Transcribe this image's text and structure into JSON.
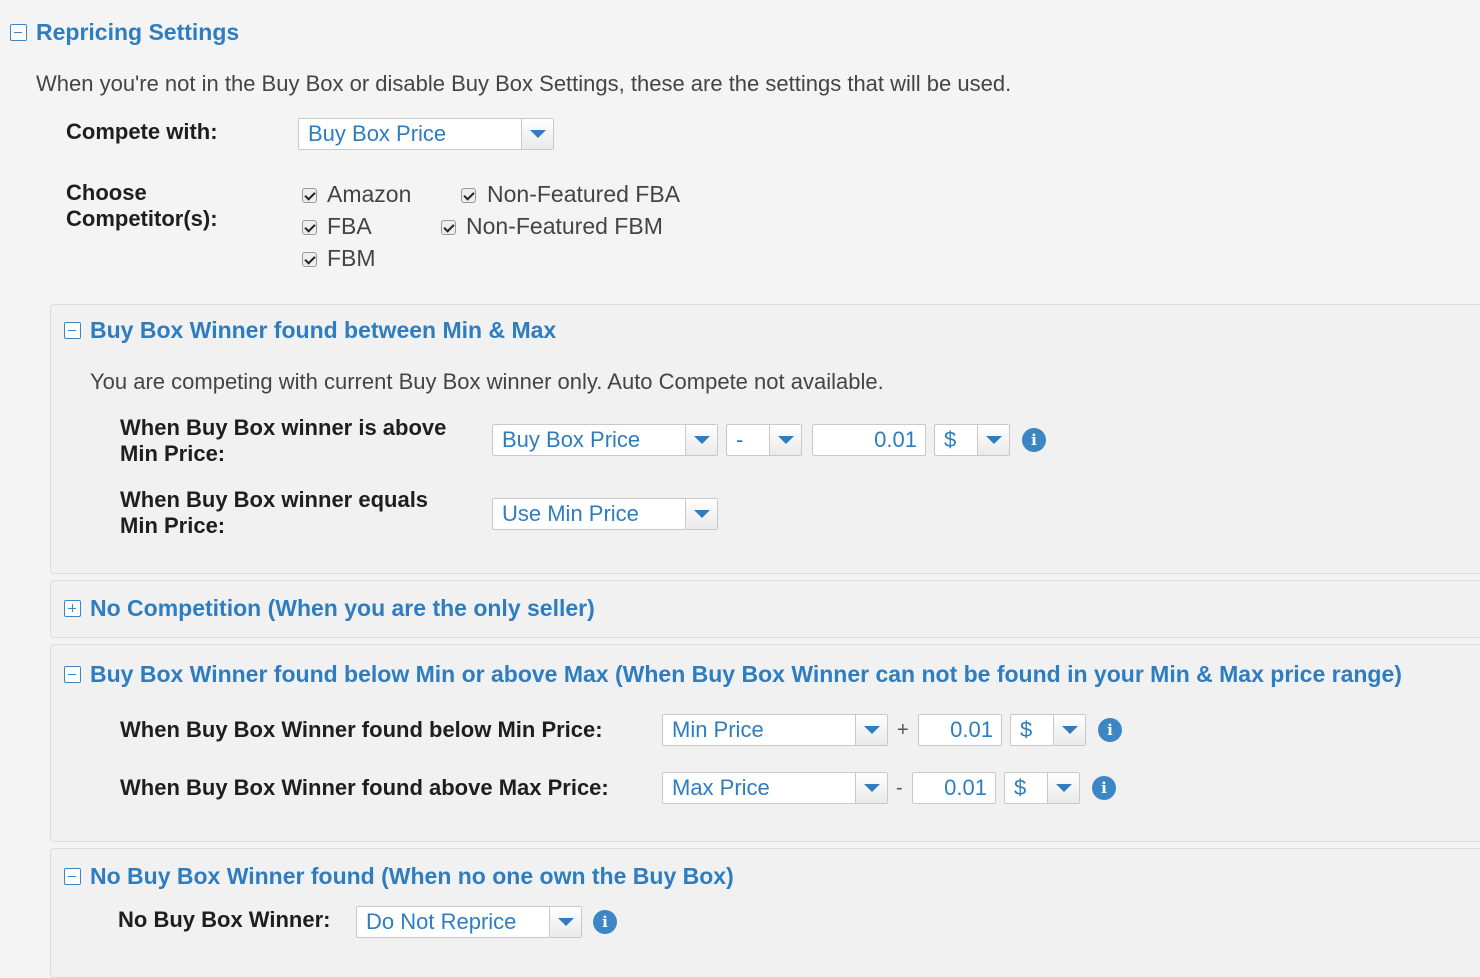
{
  "repricing": {
    "title": "Repricing Settings",
    "description": "When you're not in the Buy Box or disable Buy Box Settings, these are the settings that will be used.",
    "compete_with_label": "Compete with:",
    "compete_with_value": "Buy Box Price",
    "choose_label_1": "Choose",
    "choose_label_2": "Competitor(s):",
    "competitors": [
      {
        "label": "Amazon",
        "checked": true
      },
      {
        "label": "FBA",
        "checked": true
      },
      {
        "label": "FBM",
        "checked": true
      },
      {
        "label": "Non-Featured FBA",
        "checked": true
      },
      {
        "label": "Non-Featured FBM",
        "checked": true
      }
    ]
  },
  "section_between": {
    "title": "Buy Box Winner found between Min & Max",
    "description": "You are competing with current Buy Box winner only. Auto Compete not available.",
    "above_label_1": "When Buy Box winner is above",
    "above_label_2": "Min Price:",
    "above_price": "Buy Box Price",
    "above_operator": "-",
    "above_amount": "0.01",
    "above_unit": "$",
    "equals_label_1": "When Buy Box winner equals",
    "equals_label_2": "Min Price:",
    "equals_value": "Use Min Price"
  },
  "section_no_competition": {
    "title": "No Competition (When you are the only seller)"
  },
  "section_outside": {
    "title": "Buy Box Winner found below Min or above Max (When Buy Box Winner can not be found in your Min & Max price range)",
    "below_label": "When Buy Box Winner found below Min Price:",
    "below_price": "Min Price",
    "below_operator": "+",
    "below_amount": "0.01",
    "below_unit": "$",
    "above_label": "When Buy Box Winner found above Max Price:",
    "above_price": "Max Price",
    "above_operator": "-",
    "above_amount": "0.01",
    "above_unit": "$"
  },
  "section_no_winner": {
    "title": "No Buy Box Winner found (When no one own the Buy Box)",
    "label": "No Buy Box Winner:",
    "value": "Do Not Reprice"
  },
  "info_glyph": "i"
}
